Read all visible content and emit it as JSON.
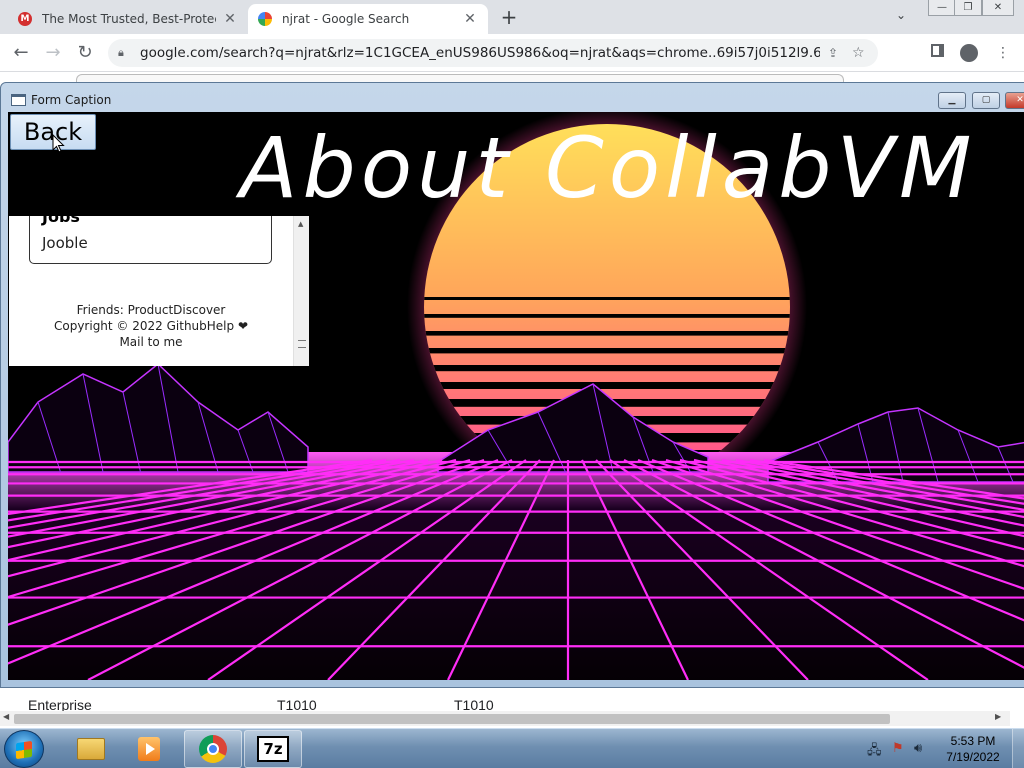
{
  "browser": {
    "tabs": [
      {
        "title": "The Most Trusted, Best-Protected",
        "favicon": "M"
      },
      {
        "title": "njrat - Google Search"
      }
    ],
    "url": "google.com/search?q=njrat&rlz=1C1GCEA_enUS986US986&oq=njrat&aqs=chrome..69i57j0i512l9.6991j0j7&sou..."
  },
  "background_page": {
    "rows": [
      {
        "col1": "Enterprise",
        "col2": "T1010",
        "col3": "T1010"
      }
    ]
  },
  "form": {
    "title": "Form Caption",
    "back_label": "Back",
    "heading": "About CollabVM",
    "panel": {
      "card_title": "Jobs",
      "card_value": "Jooble",
      "footer_line1": "Friends: ProductDiscover",
      "footer_line2": "Copyright © 2022 GithubHelp ❤",
      "footer_line3": "Mail to me"
    }
  },
  "taskbar": {
    "time": "5:53 PM",
    "date": "7/19/2022",
    "app_7z_label": "7z"
  },
  "colors": {
    "neon_pink": "#ff2df7",
    "sun_top": "#ffe35a",
    "sun_bottom": "#ff3b9b"
  }
}
